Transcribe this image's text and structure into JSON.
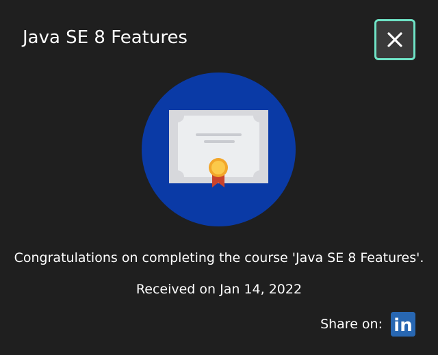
{
  "dialog": {
    "title": "Java SE 8 Features",
    "close_icon": "close-icon",
    "badge_icon": "certificate-icon",
    "badge_color": "#0a3aa6",
    "accent_color": "#6fe3c6",
    "message": "Congratulations on completing the course 'Java SE 8 Features'.",
    "received": "Received on Jan 14, 2022",
    "share": {
      "label": "Share on:",
      "linkedin_icon": "linkedin-icon",
      "linkedin_text": "in",
      "linkedin_color": "#2867b2"
    }
  }
}
